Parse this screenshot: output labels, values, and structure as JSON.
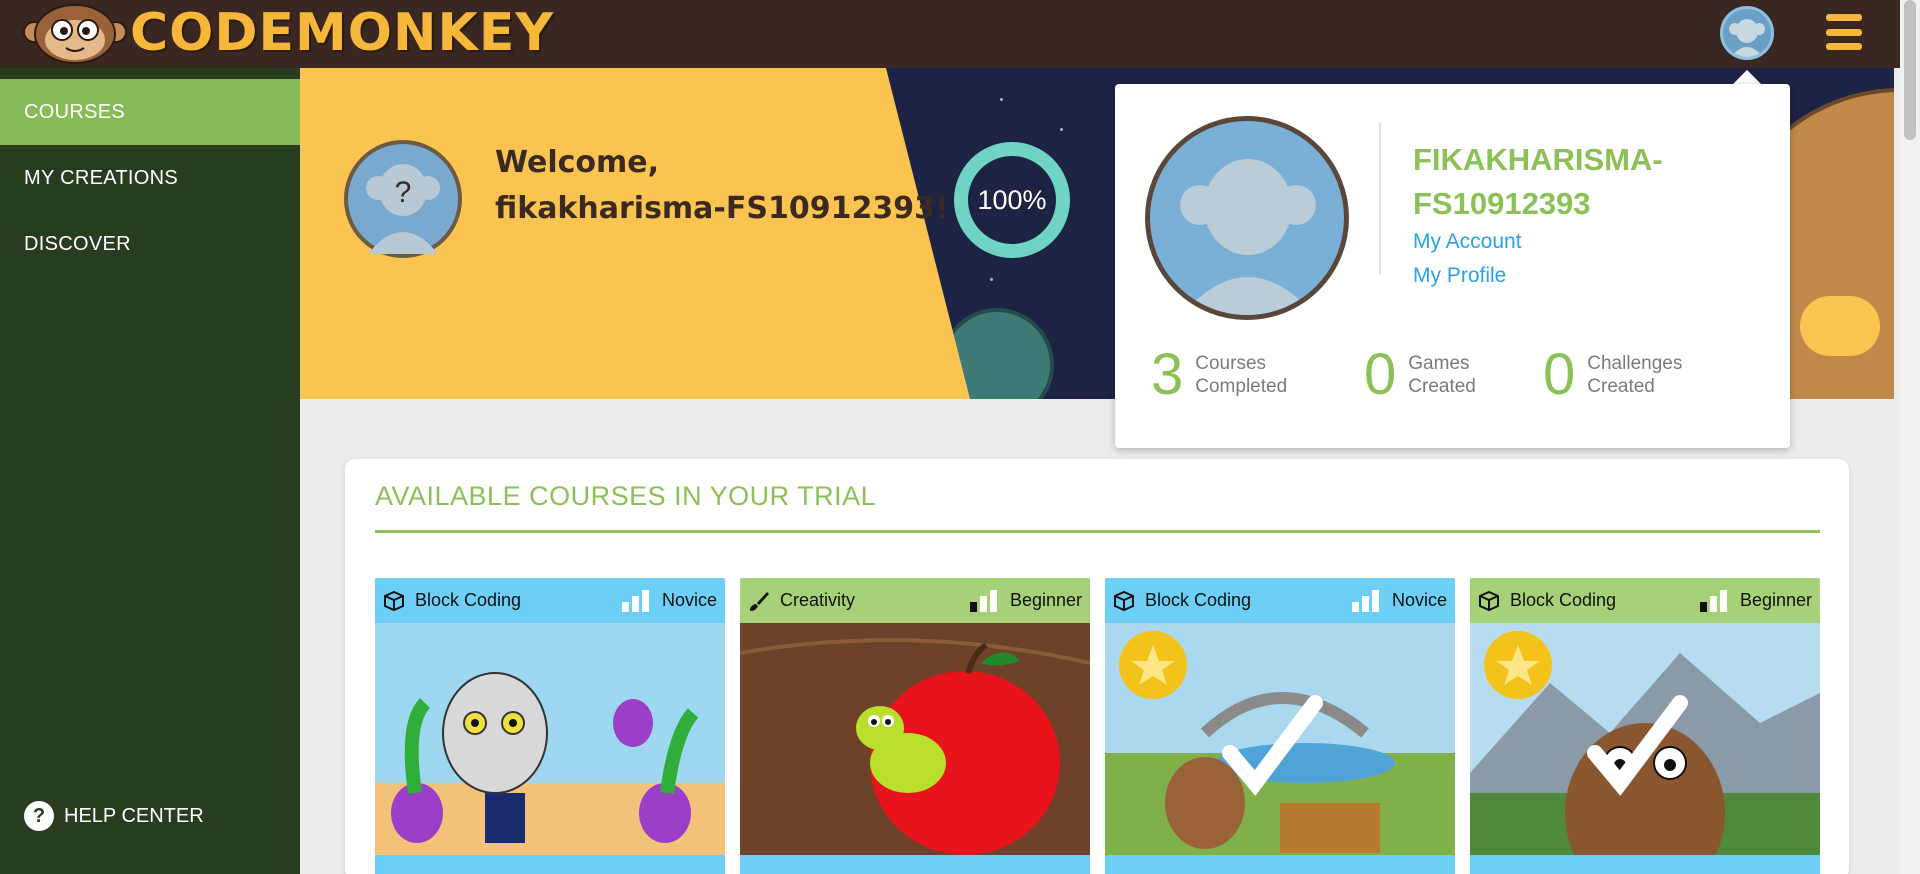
{
  "app": {
    "logo_text": "CODEMONKEY"
  },
  "sidebar": {
    "items": [
      {
        "label": "COURSES",
        "active": true
      },
      {
        "label": "MY CREATIONS",
        "active": false
      },
      {
        "label": "DISCOVER",
        "active": false
      }
    ],
    "help_label": "HELP CENTER"
  },
  "hero": {
    "welcome_line1": "Welcome,",
    "welcome_line2": "fikakharisma-FS10912393!",
    "progress_text": "100%",
    "progress_value": 1.0
  },
  "profile_popup": {
    "username": "FIKAKHARISMA-FS10912393",
    "links": [
      "My Account",
      "My Profile"
    ],
    "stats": [
      {
        "value": "3",
        "label_line1": "Courses",
        "label_line2": "Completed"
      },
      {
        "value": "0",
        "label_line1": "Games",
        "label_line2": "Created"
      },
      {
        "value": "0",
        "label_line1": "Challenges",
        "label_line2": "Created"
      }
    ]
  },
  "courses": {
    "title": "AVAILABLE COURSES IN YOUR TRIAL",
    "cards": [
      {
        "category": "Block Coding",
        "level": "Novice",
        "icon": "cube-icon",
        "header_color": "#6ecff6",
        "completed": false
      },
      {
        "category": "Creativity",
        "level": "Beginner",
        "icon": "paintbrush-icon",
        "header_color": "#a6d178",
        "completed": false
      },
      {
        "category": "Block Coding",
        "level": "Novice",
        "icon": "cube-icon",
        "header_color": "#6ecff6",
        "completed": true
      },
      {
        "category": "Block Coding",
        "level": "Beginner",
        "icon": "cube-icon",
        "header_color": "#a6d178",
        "completed": true
      }
    ]
  },
  "colors": {
    "accent_green": "#8cc157",
    "link_blue": "#29a3e6",
    "topbar_brown": "#3a2721",
    "sidebar_green": "#283d1f",
    "brand_yellow": "#fbc451"
  }
}
